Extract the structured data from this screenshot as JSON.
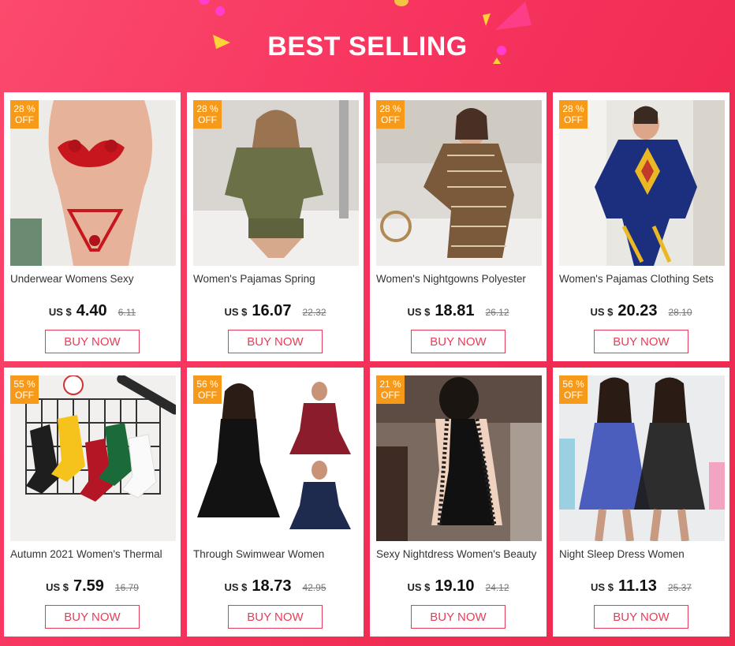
{
  "header": {
    "title": "BEST SELLING"
  },
  "colors": {
    "background": "#f7345f",
    "badge": "#f79a1a",
    "button": "#e63d58"
  },
  "currency": "US $",
  "off_label": "OFF",
  "products": [
    {
      "name": "Underwear Womens Sexy",
      "discount": "28 %",
      "price": "4.40",
      "old_price": "6.11",
      "button": "BUY NOW",
      "image": "red-lingerie-photo"
    },
    {
      "name": "Women's Pajamas Spring",
      "discount": "28 %",
      "price": "16.07",
      "old_price": "22.32",
      "button": "BUY NOW",
      "image": "olive-satin-pajamas-photo"
    },
    {
      "name": "Women's Nightgowns Polyester",
      "discount": "28 %",
      "price": "18.81",
      "old_price": "26.12",
      "button": "BUY NOW",
      "image": "brown-print-pajamas-photo"
    },
    {
      "name": "Women's Pajamas Clothing Sets",
      "discount": "28 %",
      "price": "20.23",
      "old_price": "28.10",
      "button": "BUY NOW",
      "image": "blue-yellow-pajamas-photo"
    },
    {
      "name": "Autumn 2021 Women's Thermal",
      "discount": "55 %",
      "price": "7.59",
      "old_price": "16.79",
      "button": "BUY NOW",
      "image": "striped-socks-photo"
    },
    {
      "name": "Through Swimwear Women",
      "discount": "56 %",
      "price": "18.73",
      "old_price": "42.95",
      "button": "BUY NOW",
      "image": "swim-dress-photo"
    },
    {
      "name": "Sexy Nightdress Women's Beauty",
      "discount": "21 %",
      "price": "19.10",
      "old_price": "24.12",
      "button": "BUY NOW",
      "image": "black-lace-nightdress-photo"
    },
    {
      "name": "Night Sleep Dress Women",
      "discount": "56 %",
      "price": "11.13",
      "old_price": "25.37",
      "button": "BUY NOW",
      "image": "sheer-babydoll-photo"
    }
  ]
}
